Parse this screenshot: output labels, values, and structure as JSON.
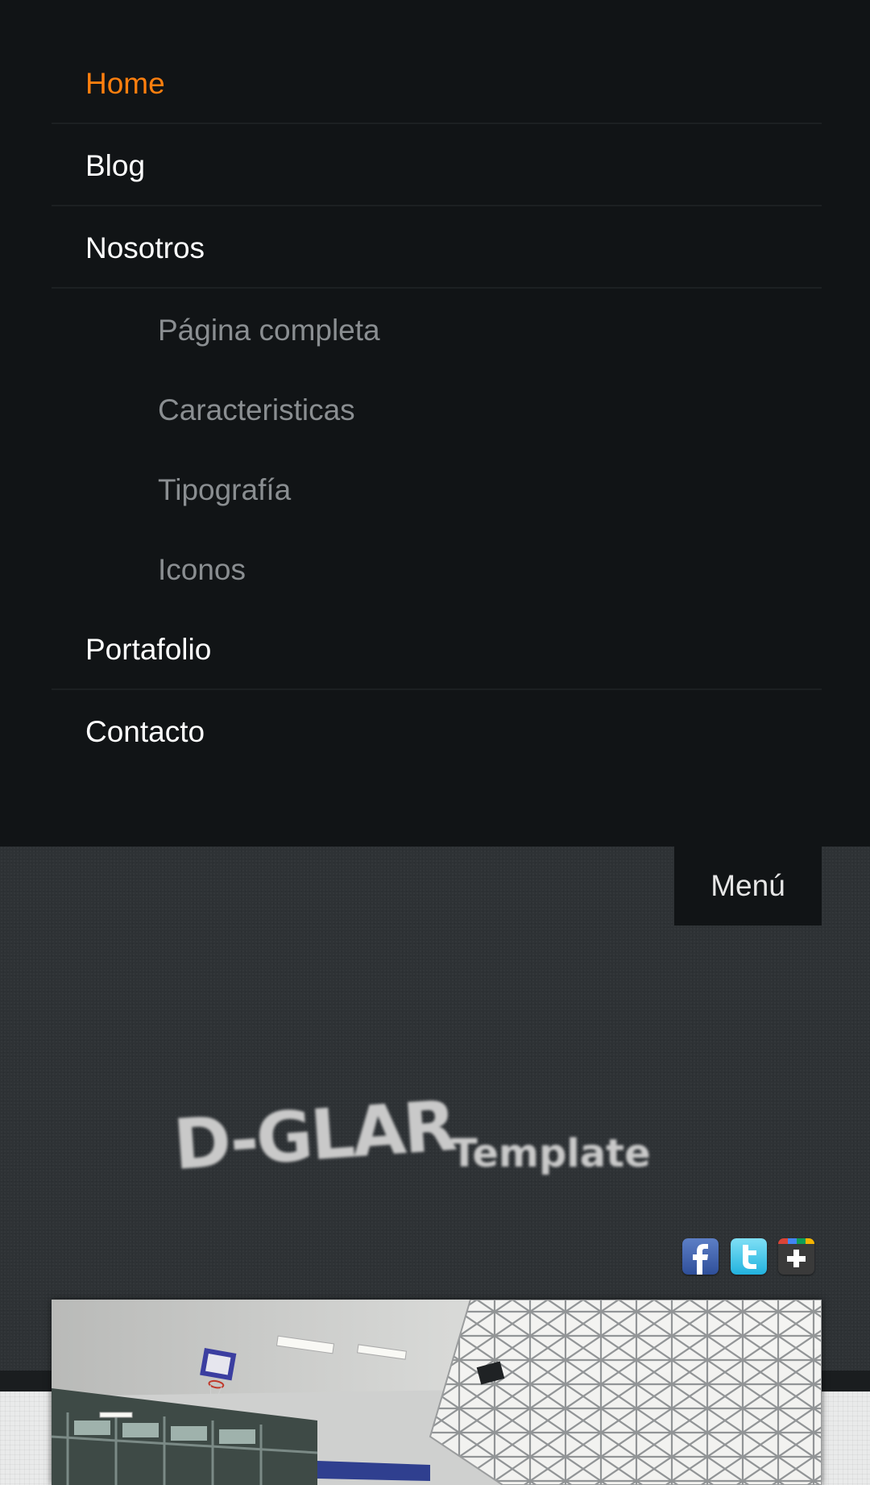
{
  "nav": {
    "items": [
      {
        "label": "Home",
        "active": true
      },
      {
        "label": "Blog"
      },
      {
        "label": "Nosotros"
      },
      {
        "label": "Portafolio"
      },
      {
        "label": "Contacto"
      }
    ],
    "subitems": [
      "Página completa",
      "Caracteristicas",
      "Tipografía",
      "Iconos"
    ]
  },
  "header": {
    "menu_label": "Menú",
    "logo_text_main": "D-GLAR",
    "logo_text_sub": "Template"
  },
  "social": {
    "icons": [
      "facebook-icon",
      "twitter-icon",
      "google-plus-icon"
    ]
  },
  "colors": {
    "accent": "#ff7f0e",
    "nav_bg": "#111416",
    "header_bg": "#2e3235"
  }
}
